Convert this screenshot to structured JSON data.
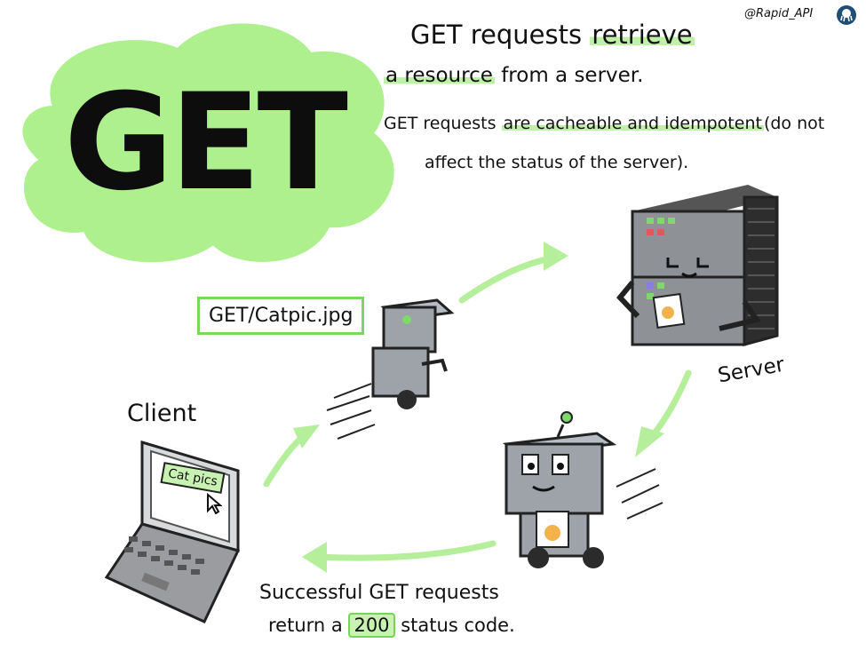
{
  "brand": {
    "handle": "@Rapid_API",
    "logo_icon": "octopus-logo-icon"
  },
  "title": {
    "word": "GET",
    "blob_color": "#aef08e"
  },
  "intro": {
    "line1_a": "GET requests",
    "line1_b": "retrieve",
    "line2_a": "a resource",
    "line2_b": "from a server."
  },
  "detail": {
    "line1_a": "GET requests",
    "line1_b": "are cacheable and idempotent",
    "line1_c": "(do not",
    "line2": "affect the status of the server)."
  },
  "request_label": "GET/Catpic.jpg",
  "client_label": "Client",
  "server_label": "Server",
  "laptop_screen_button": "Cat pics",
  "footer": {
    "line1": "Successful GET requests",
    "line2_a": "return a",
    "line2_b": "200",
    "line2_c": "status code."
  },
  "colors": {
    "accent_green": "#9de87d",
    "highlight_green": "#bff0a8",
    "arrow_green": "#b6ef9b",
    "box_border": "#7dd563"
  },
  "icons": {
    "robot_to_server": "robot-icon",
    "robot_to_client": "robot-with-cat-picture-icon",
    "server": "server-rack-icon",
    "laptop": "laptop-icon",
    "cursor": "mouse-cursor-icon",
    "cat_picture": "cat-picture-icon"
  }
}
